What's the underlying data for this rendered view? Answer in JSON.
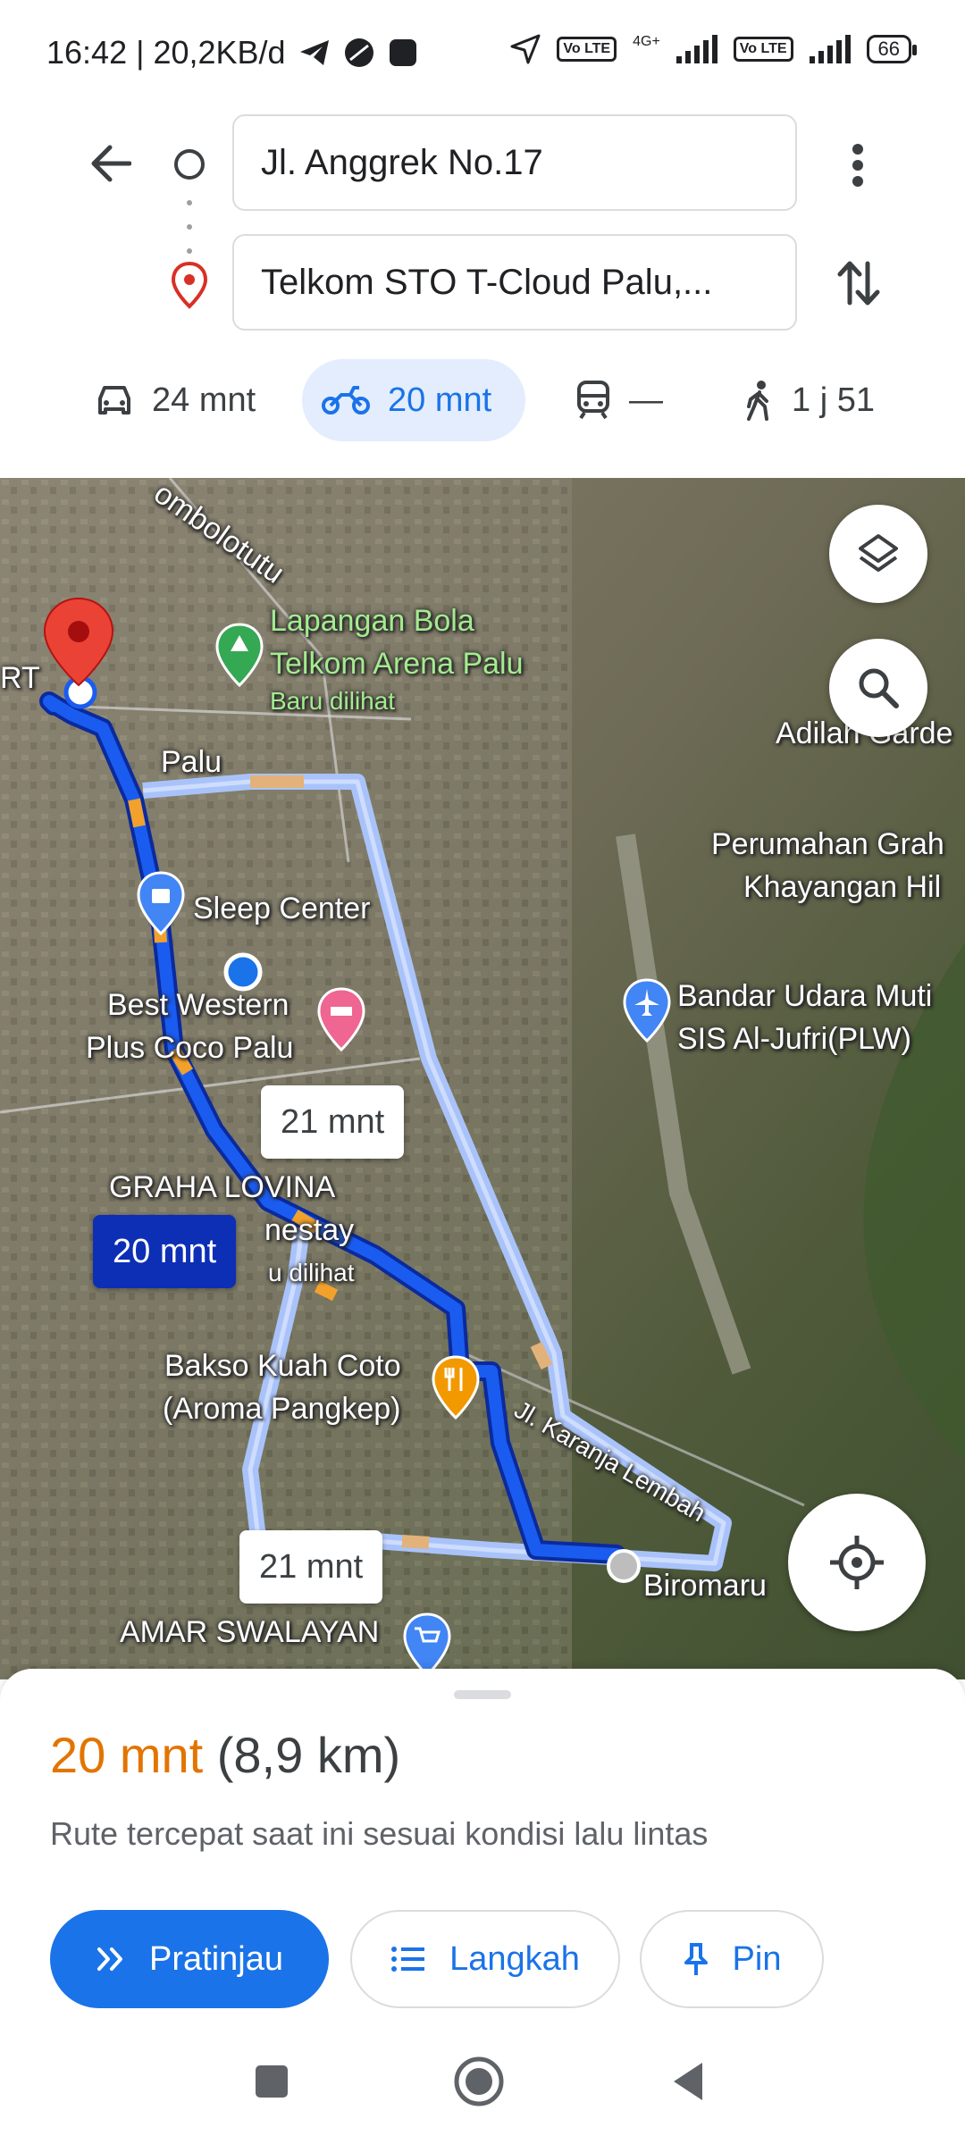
{
  "status_bar": {
    "time_speed": "16:42 | 20,2KB/d",
    "network_type": "4G+",
    "volte_label": "Vo LTE",
    "battery": "66"
  },
  "directions": {
    "origin": "Jl. Anggrek No.17",
    "destination": "Telkom STO T-Cloud Palu,..."
  },
  "travel_modes": [
    {
      "icon": "car-icon",
      "label": "24 mnt"
    },
    {
      "icon": "motorcycle-icon",
      "label": "20 mnt",
      "active": true
    },
    {
      "icon": "transit-icon",
      "label": "—"
    },
    {
      "icon": "walk-icon",
      "label": "1 j 51"
    }
  ],
  "map": {
    "labels": {
      "kombolotutu": "ombolotutu",
      "lapangan_bola_1": "Lapangan Bola",
      "lapangan_bola_2": "Telkom Arena Palu",
      "baru_dilihat_1": "Baru dilihat",
      "adilah": "Adilah Garde",
      "palu": "Palu",
      "perumahan_1": "Perumahan Grah",
      "perumahan_2": "Khayangan Hil",
      "sleep_center": "Sleep Center",
      "bandara_1": "Bandar Udara Muti",
      "bandara_2": "SIS Al-Jufri(PLW)",
      "best_western_1": "Best Western",
      "best_western_2": "Plus Coco Palu",
      "graha_lovina_1": "GRAHA LOVINA",
      "graha_lovina_2": "nestay",
      "baru_dilihat_2": "u dilihat",
      "bakso_1": "Bakso Kuah Coto",
      "bakso_2": "(Aroma Pangkep)",
      "jl_karanja": "Jl. Karanja Lembah",
      "biromaru": "Biromaru",
      "amar": "AMAR SWALAYAN",
      "rt": "RT"
    },
    "eta_main": "20 mnt",
    "eta_alt_1": "21 mnt",
    "eta_alt_2": "21 mnt",
    "route_color": "#1a5cf0",
    "alt_route_color": "#a9c3fa"
  },
  "sheet": {
    "time": "20 mnt",
    "distance": "(8,9 km)",
    "description": "Rute tercepat saat ini sesuai kondisi lalu lintas",
    "preview_label": "Pratinjau",
    "steps_label": "Langkah",
    "pin_label": "Pin"
  }
}
